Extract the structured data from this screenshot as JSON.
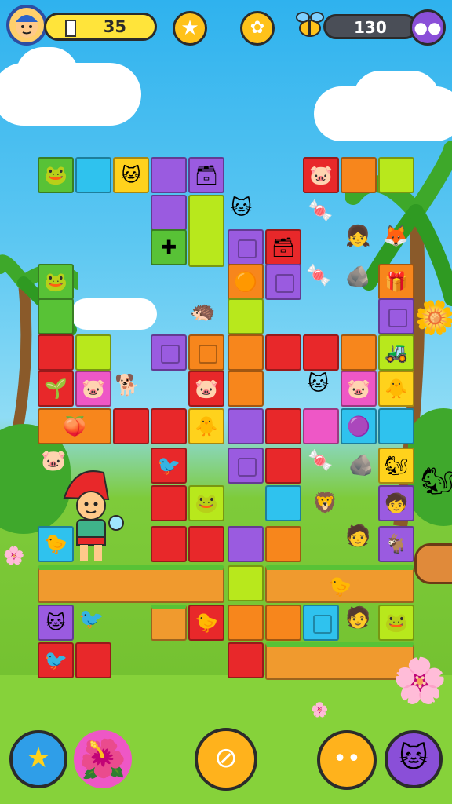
{
  "hud": {
    "coins_value": "35",
    "progress_fraction": 0.1,
    "score_value": "130",
    "avatar_icon": "player-avatar-icon",
    "star_icon": "star-icon",
    "coin_icon": "coin-icon",
    "bee_icon": "bee-icon",
    "menu_icon": "menu-icon"
  },
  "board": {
    "colors": {
      "green": "#58c236",
      "lime": "#b8e81c",
      "cyan": "#2fc2ee",
      "purple": "#9a5be0",
      "red": "#e8282a",
      "orange": "#f7861c",
      "yellow": "#ffd21c",
      "pink": "#ee57c6",
      "ground": "#f09a2e"
    }
  },
  "bottom_bar": {
    "star_icon": "star-icon",
    "flower_icon": "flower-icon",
    "cancel_icon": "cancel-icon",
    "face_icon": "smile-icon",
    "pet_icon": "pet-icon"
  }
}
